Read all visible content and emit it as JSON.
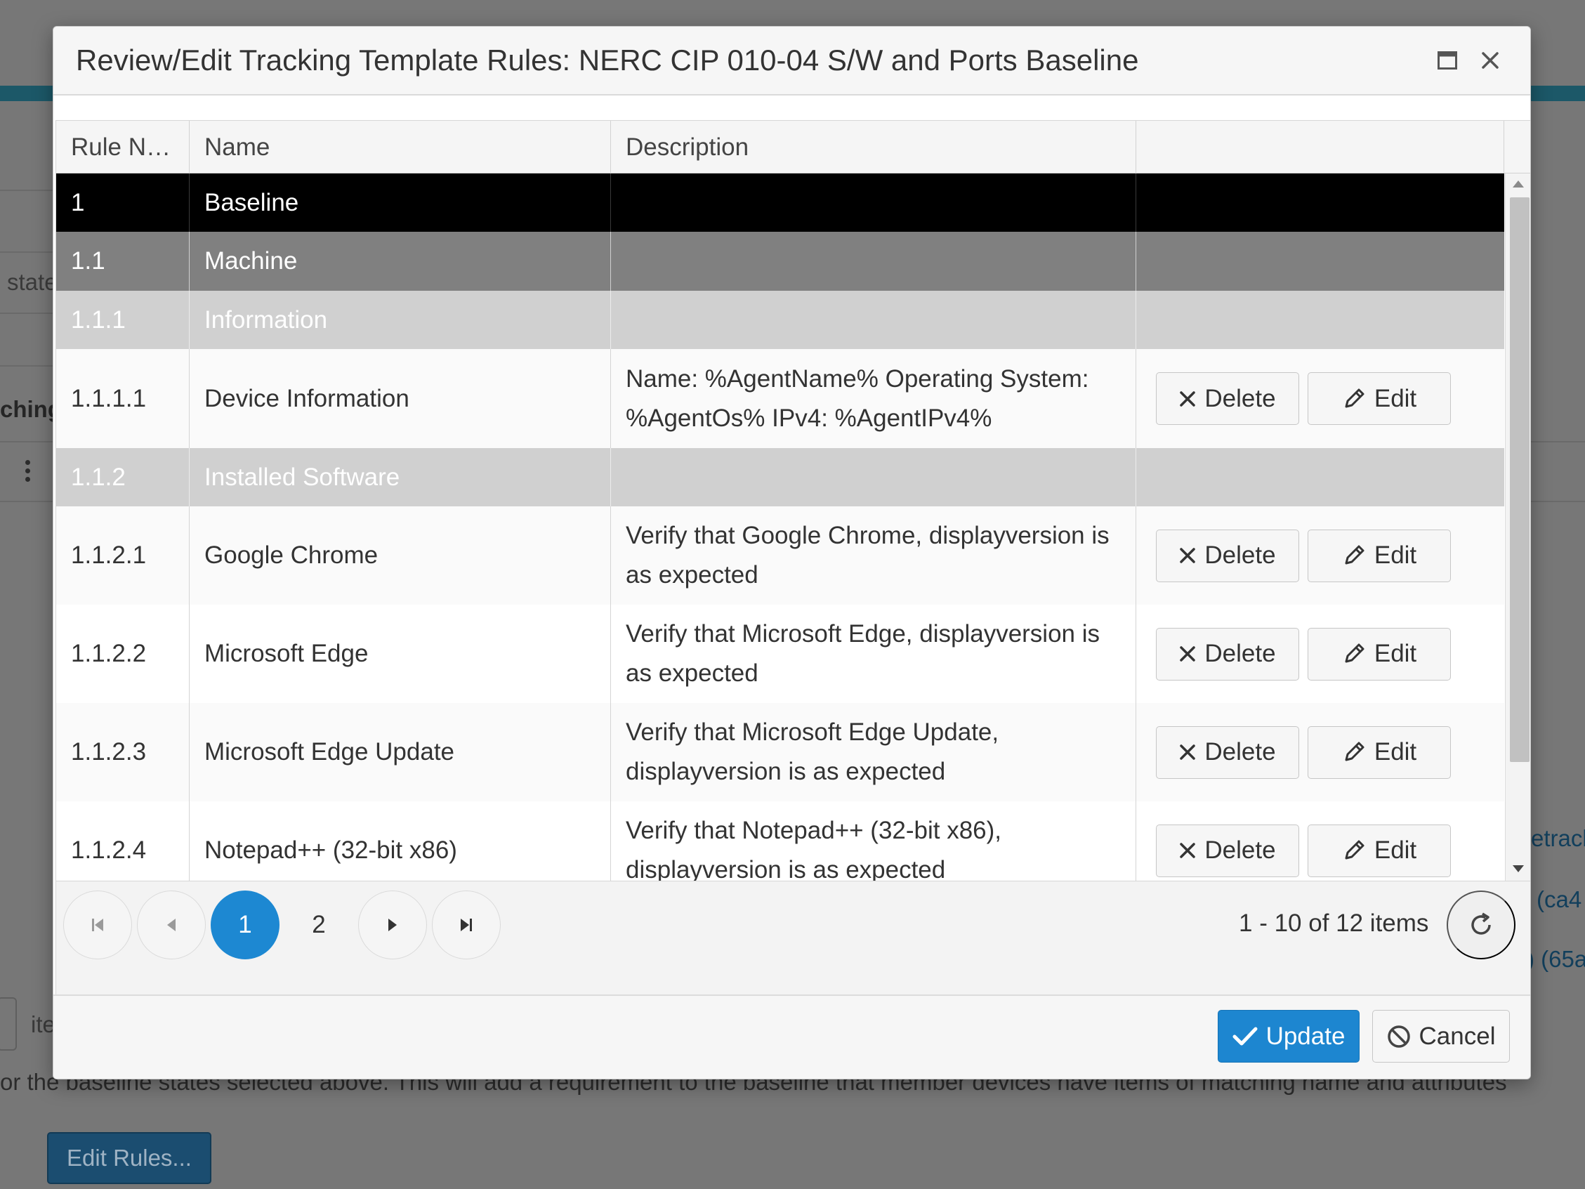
{
  "background": {
    "partial_text_state": "state",
    "partial_text_matching": "ching",
    "partial_text_items": "ite",
    "partial_link_track": "etrack",
    "partial_link_ca": "(ca4",
    "partial_link_65": ") (65a",
    "instruction_text": "or the baseline states selected above. This will add a requirement to the baseline that member devices have items of matching name and attributes",
    "edit_rules_label": "Edit Rules..."
  },
  "modal": {
    "title": "Review/Edit Tracking Template Rules: NERC CIP 010-04 S/W and Ports Baseline",
    "columns": {
      "rule_number": "Rule N…",
      "name": "Name",
      "description": "Description",
      "actions": ""
    },
    "rows": [
      {
        "rule": "1",
        "name": "Baseline",
        "description": ""
      },
      {
        "rule": "1.1",
        "name": "Machine",
        "description": ""
      },
      {
        "rule": "1.1.1",
        "name": "Information",
        "description": ""
      },
      {
        "rule": "1.1.1.1",
        "name": "Device Information",
        "description": "Name: %AgentName% Operating System: %AgentOs% IPv4: %AgentIPv4%"
      },
      {
        "rule": "1.1.2",
        "name": "Installed Software",
        "description": ""
      },
      {
        "rule": "1.1.2.1",
        "name": "Google Chrome",
        "description": "Verify that Google Chrome, displayversion is as expected"
      },
      {
        "rule": "1.1.2.2",
        "name": "Microsoft Edge",
        "description": "Verify that Microsoft Edge, displayversion is as expected"
      },
      {
        "rule": "1.1.2.3",
        "name": "Microsoft Edge Update",
        "description": "Verify that Microsoft Edge Update, displayversion is as expected"
      },
      {
        "rule": "1.1.2.4",
        "name": "Notepad++ (32-bit x86)",
        "description": "Verify that Notepad++ (32-bit x86), displayversion is as expected"
      }
    ],
    "row_actions": {
      "delete_label": "Delete",
      "edit_label": "Edit"
    },
    "pager": {
      "pages": [
        "1",
        "2"
      ],
      "current_page": "1",
      "info": "1 - 10 of 12 items"
    },
    "footer": {
      "update_label": "Update",
      "cancel_label": "Cancel"
    },
    "colors": {
      "accent": "#1d88d2",
      "level1_row": "#000000",
      "level2_row": "#808080",
      "level3_row": "#d0d0d0"
    }
  }
}
